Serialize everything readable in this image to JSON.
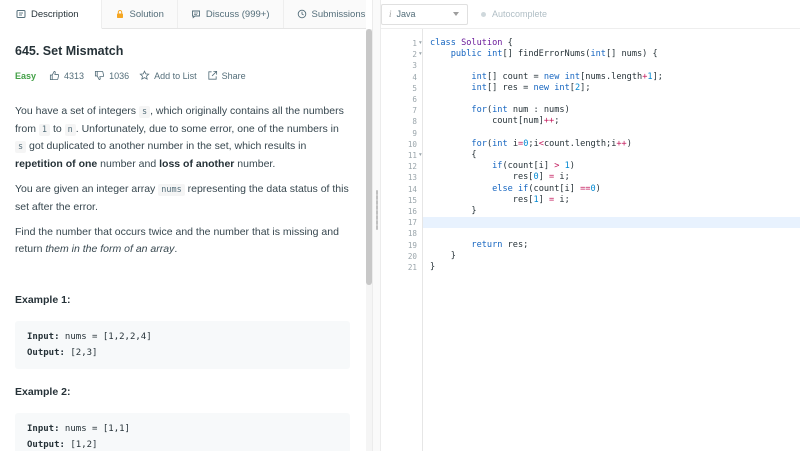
{
  "tabs": [
    {
      "label": "Description",
      "icon": "description-icon"
    },
    {
      "label": "Solution",
      "icon": "lock-icon"
    },
    {
      "label": "Discuss (999+)",
      "icon": "discuss-icon"
    },
    {
      "label": "Submissions",
      "icon": "history-icon"
    }
  ],
  "problem": {
    "title": "645. Set Mismatch",
    "difficulty": "Easy",
    "likes": "4313",
    "dislikes": "1036",
    "add_to_list": "Add to List",
    "share": "Share"
  },
  "description": {
    "p1_a": "You have a set of integers ",
    "p1_code1": "s",
    "p1_b": ", which originally contains all the numbers from ",
    "p1_code2": "1",
    "p1_c": " to ",
    "p1_code3": "n",
    "p1_d": ". Unfortunately, due to some error, one of the numbers in ",
    "p1_code4": "s",
    "p1_e": " got duplicated to another number in the set, which results in ",
    "p1_bold1": "repetition of one",
    "p1_f": " number and ",
    "p1_bold2": "loss of another",
    "p1_g": " number.",
    "p2_a": "You are given an integer array ",
    "p2_code": "nums",
    "p2_b": " representing the data status of this set after the error.",
    "p3_a": "Find the number that occurs twice and the number that is missing and return ",
    "p3_em": "them in the form of an array",
    "p3_b": "."
  },
  "examples": [
    {
      "title": "Example 1:",
      "input_label": "Input:",
      "input": " nums = [1,2,2,4]",
      "output_label": "Output:",
      "output": " [2,3]"
    },
    {
      "title": "Example 2:",
      "input_label": "Input:",
      "input": " nums = [1,1]",
      "output_label": "Output:",
      "output": " [1,2]"
    }
  ],
  "editor": {
    "language": "Java",
    "language_icon": "i",
    "autocomplete": "Autocomplete",
    "line_numbers": [
      "1",
      "2",
      "3",
      "4",
      "5",
      "6",
      "7",
      "8",
      "9",
      "10",
      "11",
      "12",
      "13",
      "14",
      "15",
      "16",
      "17",
      "18",
      "19",
      "20",
      "21"
    ],
    "fold_markers": {
      "1": "▾",
      "2": "▾",
      "11": "▾"
    },
    "active_line": 17
  },
  "colors": {
    "keyword": "#1565c0",
    "type": "#6a1b9a",
    "number": "#0288d1",
    "operator": "#c2185b",
    "easy": "#43a047",
    "active_line_bg": "#e8f2fe"
  }
}
